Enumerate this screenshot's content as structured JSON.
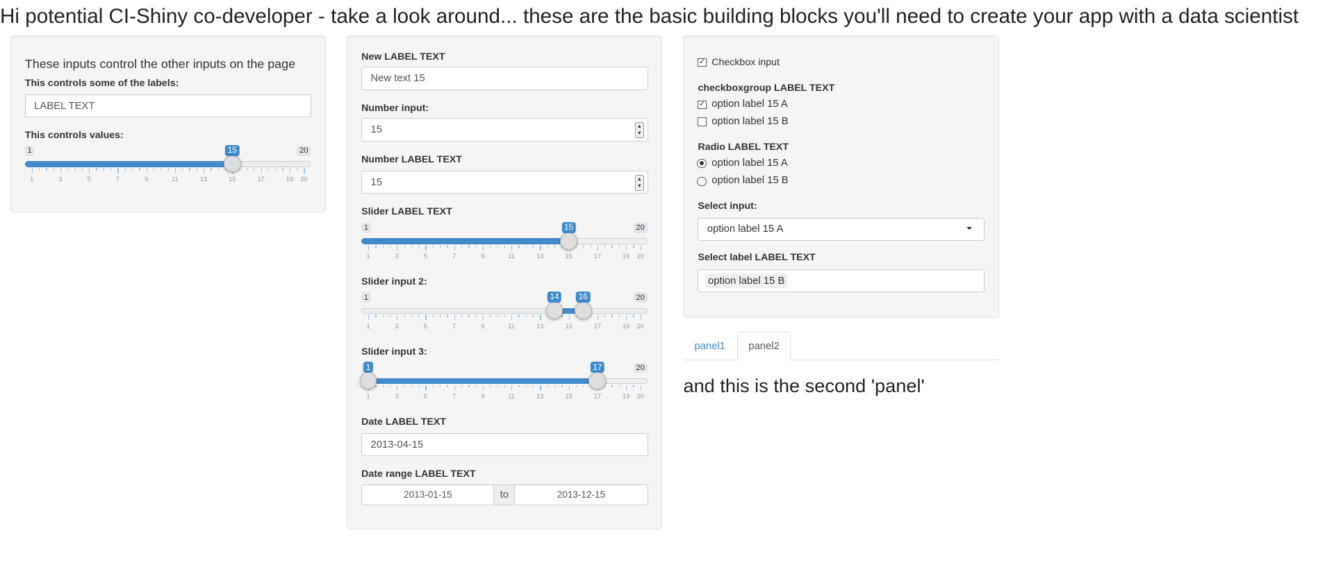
{
  "title": "Hi potential CI-Shiny co-developer - take a look around... these are the basic building blocks you'll need to create your app with a data scientist",
  "colors": {
    "accent": "#428bca",
    "well_bg": "#f5f5f5"
  },
  "control_panel": {
    "heading": "These inputs control the other inputs on the page",
    "label_control": {
      "label": "This controls some of the labels:",
      "value": "LABEL TEXT"
    },
    "value_control": {
      "label": "This controls values:",
      "min": 1,
      "max": 20,
      "values": [
        15
      ]
    }
  },
  "inputs_panel": {
    "text": {
      "label": "New LABEL TEXT",
      "value": "New text 15"
    },
    "number1": {
      "label": "Number input:",
      "value": "15"
    },
    "number2": {
      "label": "Number LABEL TEXT",
      "value": "15"
    },
    "slider1": {
      "label": "Slider LABEL TEXT",
      "min": 1,
      "max": 20,
      "values": [
        15
      ]
    },
    "slider2": {
      "label": "Slider input 2:",
      "min": 1,
      "max": 20,
      "values": [
        14,
        16
      ]
    },
    "slider3": {
      "label": "Slider input 3:",
      "min": 1,
      "max": 20,
      "values": [
        1,
        17
      ]
    },
    "date": {
      "label": "Date LABEL TEXT",
      "value": "2013-04-15"
    },
    "date_range": {
      "label": "Date range LABEL TEXT",
      "start": "2013-01-15",
      "separator": "to",
      "end": "2013-12-15"
    }
  },
  "slider_grid_labels": [
    "1",
    "3",
    "5",
    "7",
    "9",
    "11",
    "13",
    "15",
    "17",
    "19",
    "20"
  ],
  "choices_panel": {
    "checkbox": {
      "label": "Checkbox input",
      "checked": true
    },
    "checkbox_group": {
      "label": "checkboxgroup LABEL TEXT",
      "options": [
        {
          "label": "option label 15 A",
          "checked": true
        },
        {
          "label": "option label 15 B",
          "checked": false
        }
      ]
    },
    "radio": {
      "label": "Radio LABEL TEXT",
      "options": [
        {
          "label": "option label 15 A",
          "selected": true
        },
        {
          "label": "option label 15 B",
          "selected": false
        }
      ]
    },
    "select": {
      "label": "Select input:",
      "value": "option label 15 A"
    },
    "select2": {
      "label": "Select label LABEL TEXT",
      "value": "option label 15 B"
    }
  },
  "tabs": {
    "items": [
      {
        "label": "panel1",
        "active": false
      },
      {
        "label": "panel2",
        "active": true
      }
    ],
    "content": "and this is the second 'panel'"
  }
}
